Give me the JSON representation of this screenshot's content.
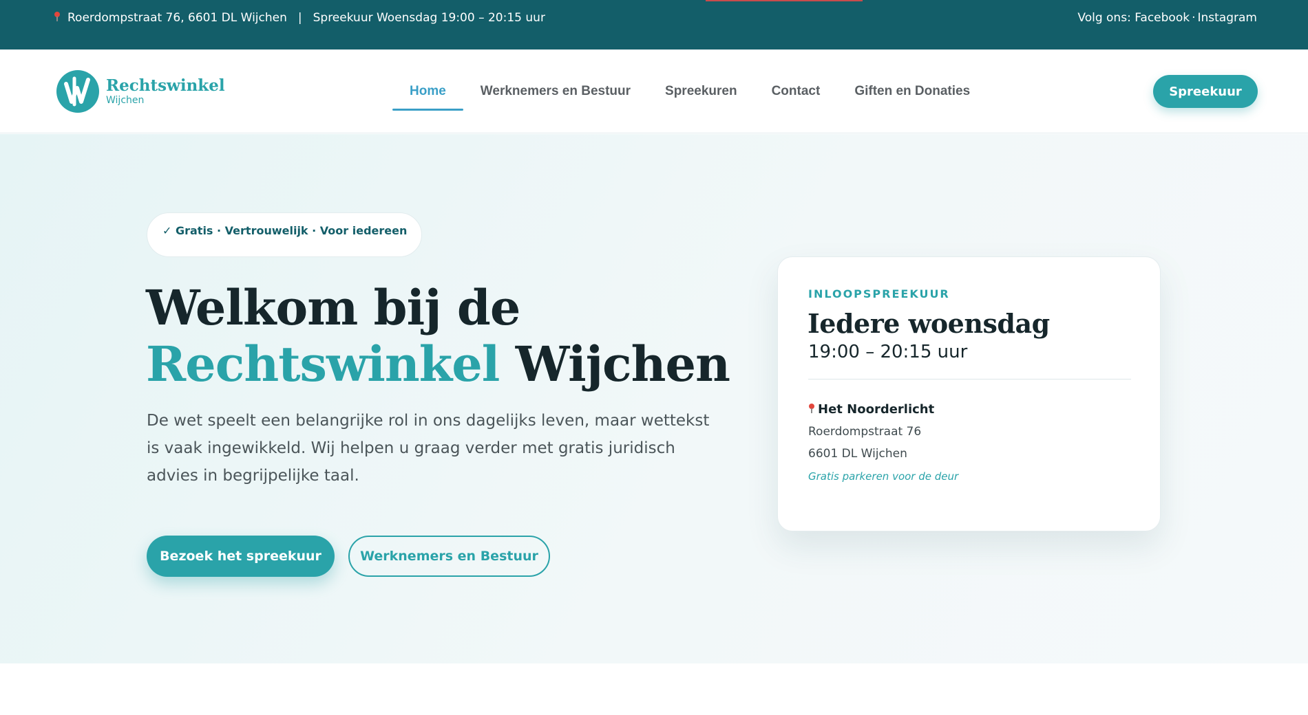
{
  "topbar": {
    "address": "Roerdompstraat 76, 6601 DL Wijchen",
    "separator": "|",
    "hours": "Spreekuur Woensdag 19:00 – 20:15 uur",
    "follow_label": "Volg ons:",
    "facebook": "Facebook",
    "dot": "·",
    "instagram": "Instagram"
  },
  "logo": {
    "name": "Rechtswinkel",
    "city": "Wijchen"
  },
  "nav": {
    "items": [
      {
        "label": "Home",
        "active": true
      },
      {
        "label": "Werknemers en Bestuur"
      },
      {
        "label": "Spreekuren"
      },
      {
        "label": "Contact"
      },
      {
        "label": "Giften en Donaties"
      }
    ],
    "cta": "Spreekuur"
  },
  "hero": {
    "badge": "✓ Gratis · Vertrouwelijk · Voor iedereen",
    "headline_line1": "Welkom bij de",
    "headline_teal": "Rechtswinkel",
    "headline_rest": "Wijchen",
    "lead": "De wet speelt een belangrijke rol in ons dagelijks leven, maar wettekst is vaak ingewikkeld. Wij helpen u graag verder met gratis juridisch advies in begrijpelijke taal.",
    "primary_button": "Bezoek het spreekuur",
    "secondary_button": "Werknemers en Bestuur"
  },
  "card": {
    "eyebrow": "INLOOPSPREEKUUR",
    "day": "Iedere woensdag",
    "time": "19:00 – 20:15 uur",
    "location_name": "Het Noorderlicht",
    "address_line1": "Roerdompstraat 76",
    "address_line2": "6601 DL Wijchen",
    "note": "Gratis parkeren voor de deur"
  },
  "colors": {
    "topbar_bg": "#135e69",
    "accent": "#2aa3a9",
    "nav_active": "#3a9fc7",
    "heading": "#16262b"
  },
  "icons": {
    "location": "map-pin-icon",
    "logo": "rechtswinkel-logo-icon"
  }
}
